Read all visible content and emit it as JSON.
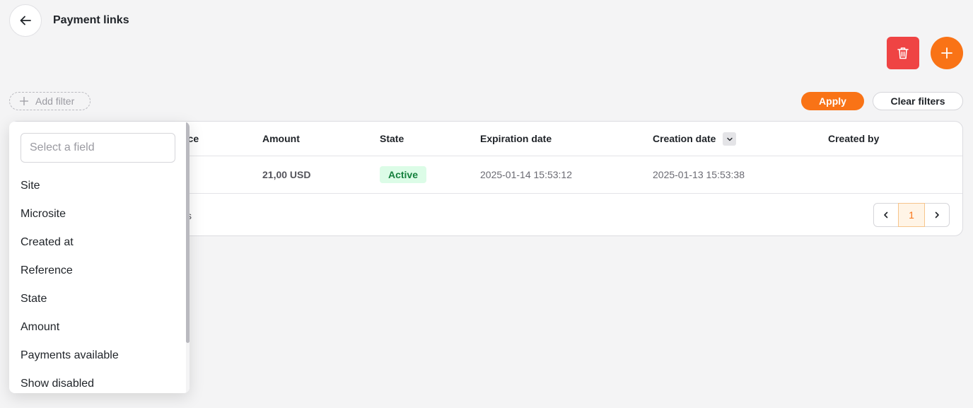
{
  "header": {
    "title": "Payment links"
  },
  "filters": {
    "add_filter_label": "Add filter",
    "apply_label": "Apply",
    "clear_label": "Clear filters"
  },
  "table": {
    "columns": [
      "nce",
      "Amount",
      "State",
      "Expiration date",
      "Creation date",
      "Created by"
    ],
    "rows": [
      {
        "amount": "21,00 USD",
        "state": "Active",
        "expiration": "2025-01-14 15:53:12",
        "creation": "2025-01-13 15:53:38",
        "created_by": ""
      }
    ],
    "footer_fragment": "s",
    "pagination": {
      "current_page": "1"
    }
  },
  "field_dropdown": {
    "search_placeholder": "Select a field",
    "options": [
      "Site",
      "Microsite",
      "Created at",
      "Reference",
      "State",
      "Amount",
      "Payments available",
      "Show disabled"
    ]
  },
  "colors": {
    "accent": "#f97316",
    "danger": "#ef4444",
    "success_bg": "#dcfce7",
    "success_text": "#15803d"
  },
  "icons": [
    "arrow-left-icon",
    "trash-icon",
    "plus-icon",
    "chevron-down-icon",
    "chevron-left-icon",
    "chevron-right-icon"
  ]
}
